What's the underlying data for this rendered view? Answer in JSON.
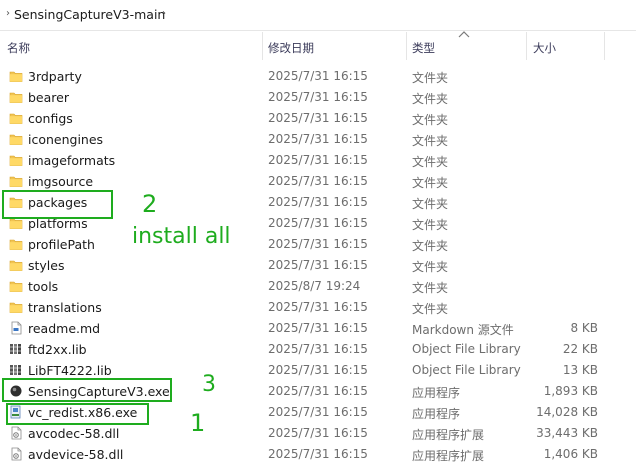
{
  "breadcrumb": {
    "folder": "SensingCaptureV3-main"
  },
  "columns": {
    "name": "名称",
    "modified": "修改日期",
    "type": "类型",
    "size": "大小"
  },
  "files": [
    {
      "name": "3rdparty",
      "date": "2025/7/31 16:15",
      "type": "文件夹",
      "size": "",
      "icon": "folder-icon"
    },
    {
      "name": "bearer",
      "date": "2025/7/31 16:15",
      "type": "文件夹",
      "size": "",
      "icon": "folder-icon"
    },
    {
      "name": "configs",
      "date": "2025/7/31 16:15",
      "type": "文件夹",
      "size": "",
      "icon": "folder-icon"
    },
    {
      "name": "iconengines",
      "date": "2025/7/31 16:15",
      "type": "文件夹",
      "size": "",
      "icon": "folder-icon"
    },
    {
      "name": "imageformats",
      "date": "2025/7/31 16:15",
      "type": "文件夹",
      "size": "",
      "icon": "folder-icon"
    },
    {
      "name": "imgsource",
      "date": "2025/7/31 16:15",
      "type": "文件夹",
      "size": "",
      "icon": "folder-icon"
    },
    {
      "name": "packages",
      "date": "2025/7/31 16:15",
      "type": "文件夹",
      "size": "",
      "icon": "folder-icon"
    },
    {
      "name": "platforms",
      "date": "2025/7/31 16:15",
      "type": "文件夹",
      "size": "",
      "icon": "folder-icon"
    },
    {
      "name": "profilePath",
      "date": "2025/7/31 16:15",
      "type": "文件夹",
      "size": "",
      "icon": "folder-icon"
    },
    {
      "name": "styles",
      "date": "2025/7/31 16:15",
      "type": "文件夹",
      "size": "",
      "icon": "folder-icon"
    },
    {
      "name": "tools",
      "date": "2025/8/7 19:24",
      "type": "文件夹",
      "size": "",
      "icon": "folder-icon"
    },
    {
      "name": "translations",
      "date": "2025/7/31 16:15",
      "type": "文件夹",
      "size": "",
      "icon": "folder-icon"
    },
    {
      "name": "readme.md",
      "date": "2025/7/31 16:15",
      "type": "Markdown 源文件",
      "size": "8 KB",
      "icon": "markdown-file-icon"
    },
    {
      "name": "ftd2xx.lib",
      "date": "2025/7/31 16:15",
      "type": "Object File Library",
      "size": "22 KB",
      "icon": "library-file-icon"
    },
    {
      "name": "LibFT4222.lib",
      "date": "2025/7/31 16:15",
      "type": "Object File Library",
      "size": "13 KB",
      "icon": "library-file-icon"
    },
    {
      "name": "SensingCaptureV3.exe",
      "date": "2025/7/31 16:15",
      "type": "应用程序",
      "size": "1,893 KB",
      "icon": "application-icon"
    },
    {
      "name": "vc_redist.x86.exe",
      "date": "2025/7/31 16:15",
      "type": "应用程序",
      "size": "14,028 KB",
      "icon": "installer-icon"
    },
    {
      "name": "avcodec-58.dll",
      "date": "2025/7/31 16:15",
      "type": "应用程序扩展",
      "size": "33,443 KB",
      "icon": "dll-file-icon"
    },
    {
      "name": "avdevice-58.dll",
      "date": "2025/7/31 16:15",
      "type": "应用程序扩展",
      "size": "1,406 KB",
      "icon": "dll-file-icon"
    }
  ],
  "annotations": {
    "step2_number": "2",
    "step2_text": "install all",
    "step3_number": "3",
    "step1_number": "1",
    "color": "#1eac1e"
  }
}
